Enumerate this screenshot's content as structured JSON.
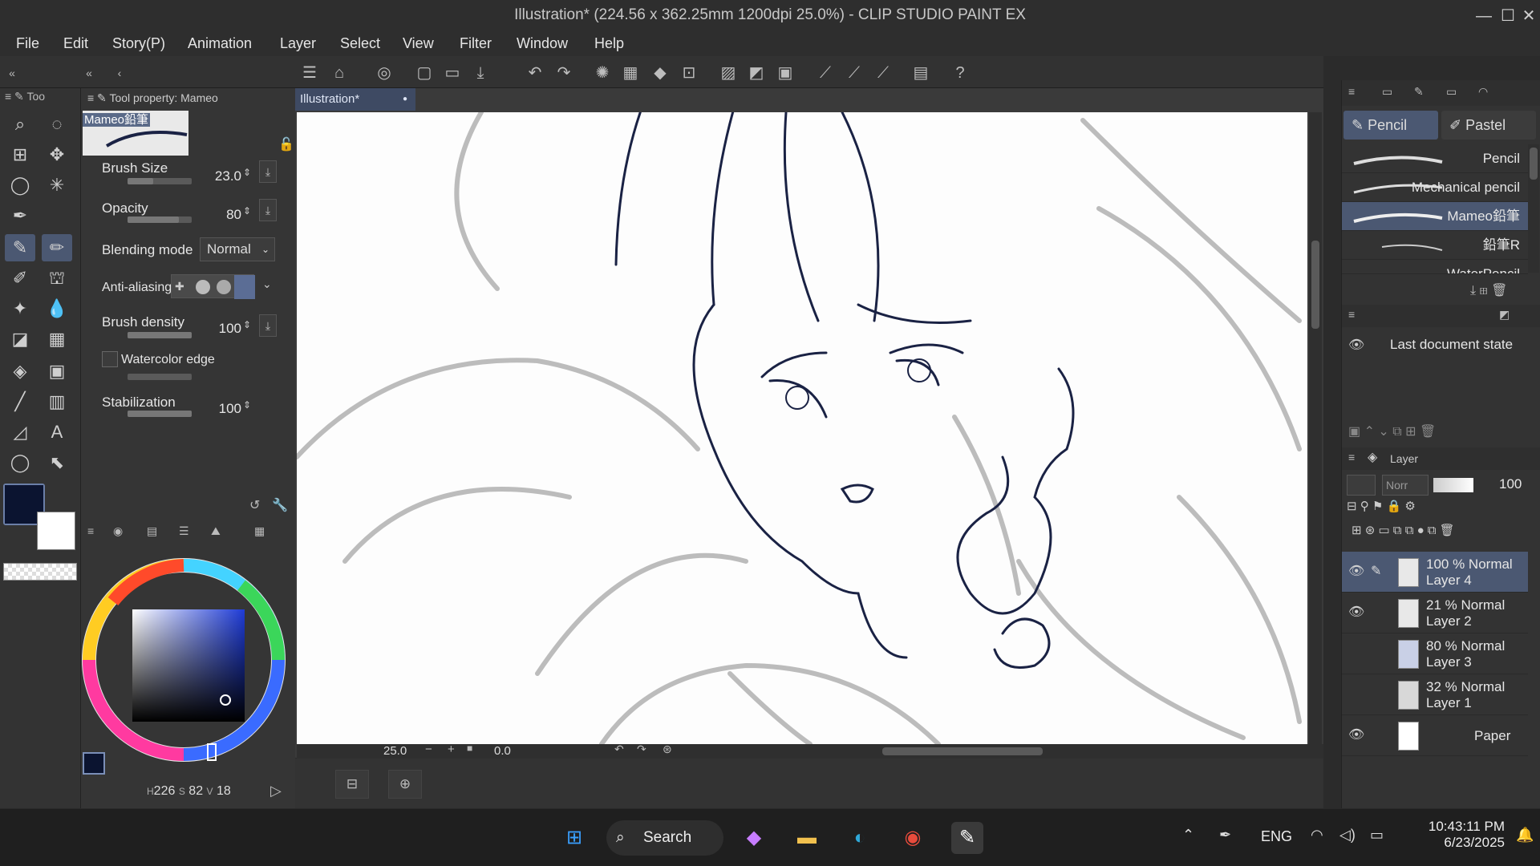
{
  "window": {
    "title": "Illustration* (224.56 x 362.25mm 1200dpi 25.0%) - CLIP STUDIO PAINT EX",
    "minimize": "—",
    "maximize": "☐",
    "close": "✕"
  },
  "menu": [
    "File",
    "Edit",
    "Story(P)",
    "Animation",
    "Layer",
    "Select",
    "View",
    "Filter",
    "Window",
    "Help"
  ],
  "tool_property": {
    "tab_label": "Tool property: Mameo",
    "tool_tab": "Too",
    "brush_name": "Mameo鉛筆",
    "brush_size_label": "Brush Size",
    "brush_size_value": "23.0",
    "opacity_label": "Opacity",
    "opacity_value": "80",
    "blending_label": "Blending mode",
    "blending_value": "Normal",
    "antialias_label": "Anti-aliasing",
    "density_label": "Brush density",
    "density_value": "100",
    "watercolor_label": "Watercolor edge",
    "stabilization_label": "Stabilization",
    "stabilization_value": "100"
  },
  "color": {
    "main": "#0b1430",
    "sub": "#ffffff",
    "h": "226",
    "s": "82",
    "v": "18",
    "h_label": "H",
    "s_label": "S",
    "v_label": "V"
  },
  "document": {
    "tab_label": "Illustration*",
    "zoom": "25.0",
    "rotation": "0.0"
  },
  "brushes": {
    "tabs": [
      "Pencil",
      "Pastel"
    ],
    "items": [
      "Pencil",
      "Mechanical pencil",
      "Mameo鉛筆",
      "鉛筆R",
      "WaterPencil"
    ]
  },
  "history": {
    "item": "Last document state"
  },
  "layers": {
    "tab_label": "Layer",
    "blend_short": "Norr",
    "opacity": "100",
    "items": [
      {
        "line1": "100 % Normal",
        "line2": "Layer 4"
      },
      {
        "line1": "21 % Normal",
        "line2": "Layer 2"
      },
      {
        "line1": "80 % Normal",
        "line2": "Layer 3"
      },
      {
        "line1": "32 % Normal",
        "line2": "Layer 1"
      },
      {
        "line1": "",
        "line2": "Paper"
      }
    ]
  },
  "taskbar": {
    "search": "Search",
    "lang": "ENG",
    "time": "10:43:11 PM",
    "date": "6/23/2025"
  }
}
